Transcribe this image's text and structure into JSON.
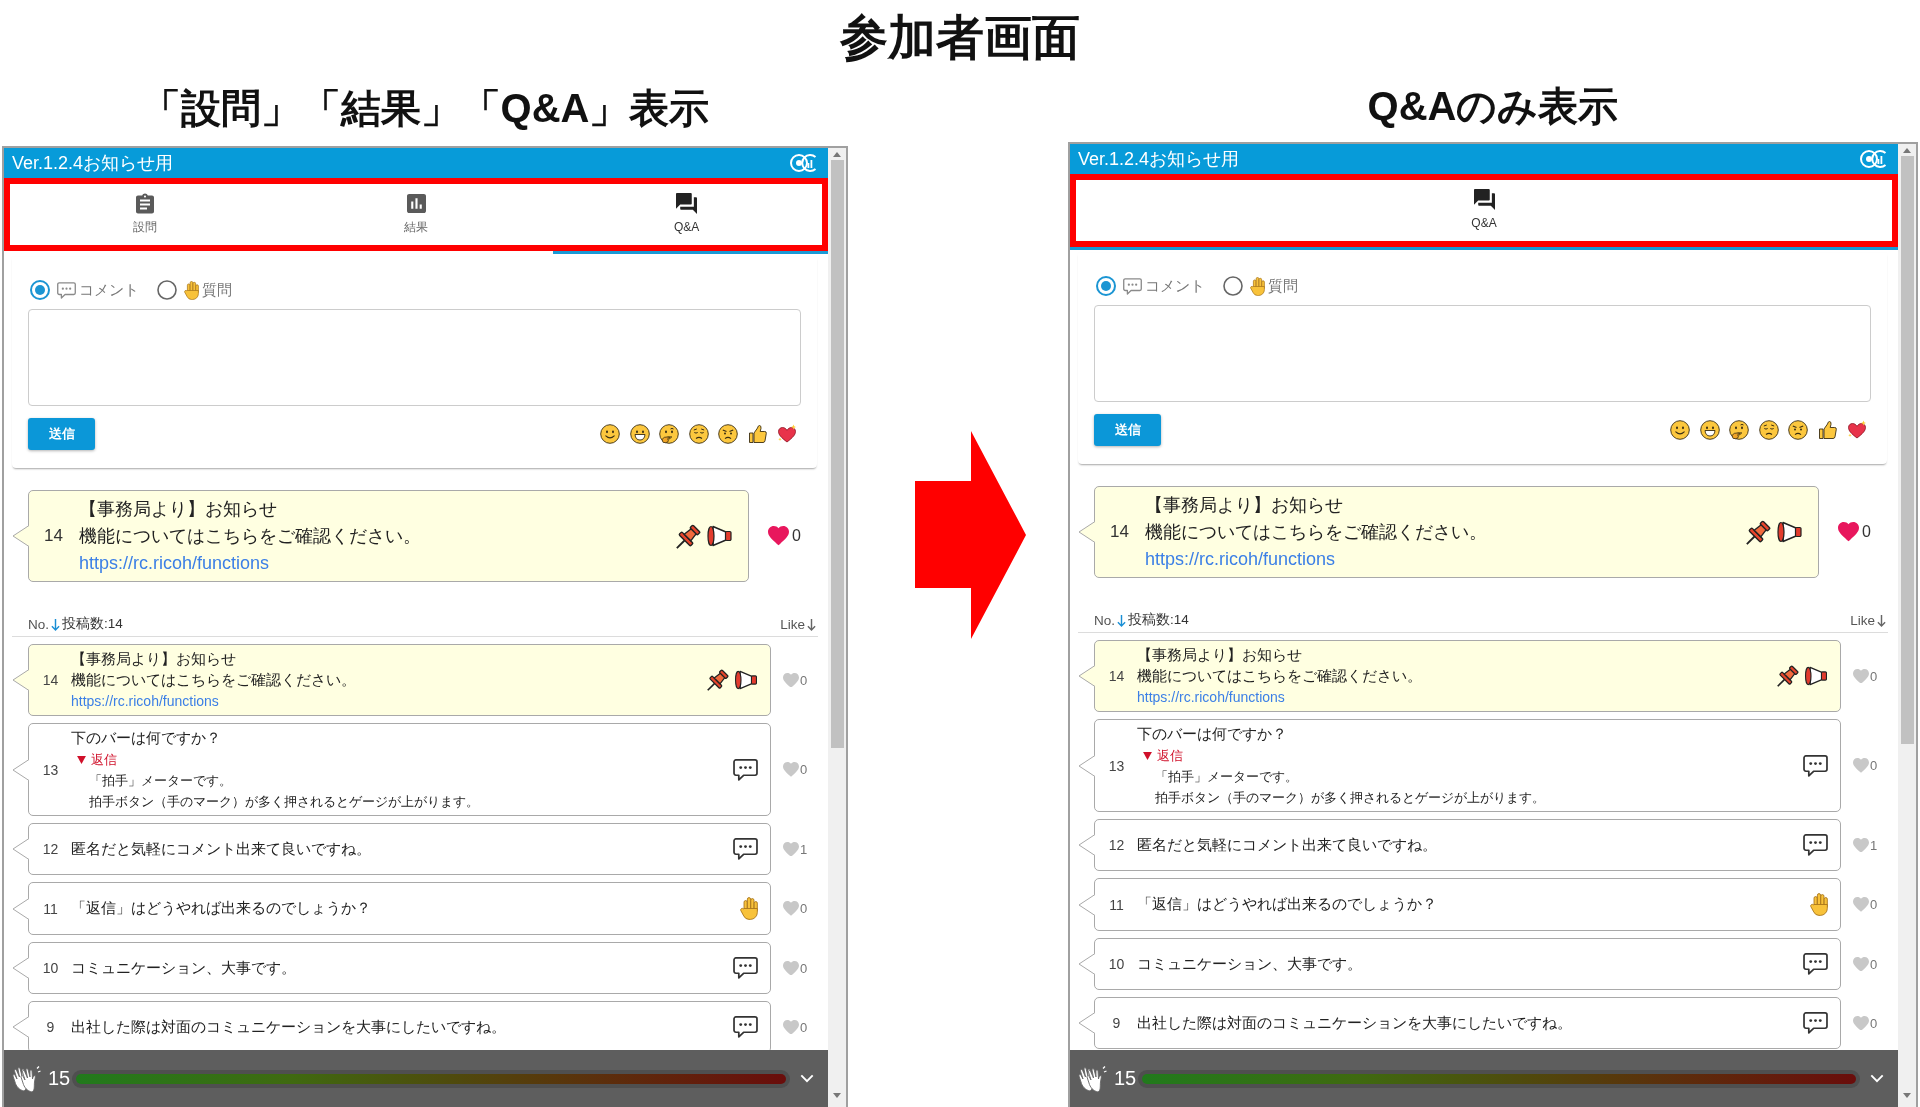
{
  "title": "参加者画面",
  "panels": [
    {
      "caption": "「設問」「結果」「Q&A」表示",
      "header": {
        "title": "Ver.1.2.4お知らせ用"
      },
      "highlight_tabs": true,
      "tabs": [
        {
          "kind": "questions",
          "label": "設問",
          "selected": false
        },
        {
          "kind": "results",
          "label": "結果",
          "selected": false
        },
        {
          "kind": "qa",
          "label": "Q&A",
          "selected": true
        }
      ],
      "composer": {
        "types": [
          {
            "kind": "comment",
            "label": "コメント",
            "selected": true
          },
          {
            "kind": "question",
            "label": "質問",
            "selected": false
          }
        ],
        "submit": "送信"
      },
      "featured": {
        "kind": "announcement",
        "number": "14",
        "lines": [
          "【事務局より】お知らせ",
          "機能についてはこちらをご確認ください。"
        ],
        "link": "https://rc.ricoh/functions",
        "likes": "0",
        "liked": true
      },
      "sort": {
        "number": {
          "label": "No.",
          "selected": true
        },
        "count": "投稿数:14",
        "like": {
          "label": "Like",
          "selected": false
        }
      },
      "posts": [
        {
          "kind": "announcement",
          "number": "14",
          "lines": [
            "【事務局より】お知らせ",
            "機能についてはこちらをご確認ください。"
          ],
          "link": "https://rc.ricoh/functions",
          "likes": "0",
          "liked": false
        },
        {
          "kind": "comment",
          "number": "13",
          "lines": [
            "下のバーは何ですか？"
          ],
          "reply": {
            "label": "返信",
            "expanded": true,
            "lines": [
              "「拍手」メーターです。",
              "拍手ボタン（手のマーク）が多く押されるとゲージが上がります。"
            ]
          },
          "likes": "0",
          "liked": false
        },
        {
          "kind": "comment",
          "number": "12",
          "lines": [
            "匿名だと気軽にコメント出来て良いですね。"
          ],
          "likes": "1",
          "liked": false
        },
        {
          "kind": "question",
          "number": "11",
          "lines": [
            "「返信」はどうやれば出来るのでしょうか？"
          ],
          "likes": "0",
          "liked": false
        },
        {
          "kind": "comment",
          "number": "10",
          "lines": [
            "コミュニケーション、大事です。"
          ],
          "likes": "0",
          "liked": false
        },
        {
          "kind": "comment",
          "number": "9",
          "lines": [
            "出社した際は対面のコミュニケーションを大事にしたいですね。"
          ],
          "likes": "0",
          "liked": false
        }
      ],
      "clap_bar": {
        "count": "15",
        "level": 1.0
      }
    },
    {
      "caption": "Q&Aのみ表示",
      "header": {
        "title": "Ver.1.2.4お知らせ用"
      },
      "highlight_tabs": true,
      "tabs": [
        {
          "kind": "qa",
          "label": "Q&A",
          "selected": true
        }
      ],
      "composer": {
        "types": [
          {
            "kind": "comment",
            "label": "コメント",
            "selected": true
          },
          {
            "kind": "question",
            "label": "質問",
            "selected": false
          }
        ],
        "submit": "送信"
      },
      "featured": {
        "kind": "announcement",
        "number": "14",
        "lines": [
          "【事務局より】お知らせ",
          "機能についてはこちらをご確認ください。"
        ],
        "link": "https://rc.ricoh/functions",
        "likes": "0",
        "liked": true
      },
      "sort": {
        "number": {
          "label": "No.",
          "selected": true
        },
        "count": "投稿数:14",
        "like": {
          "label": "Like",
          "selected": false
        }
      },
      "posts": [
        {
          "kind": "announcement",
          "number": "14",
          "lines": [
            "【事務局より】お知らせ",
            "機能についてはこちらをご確認ください。"
          ],
          "link": "https://rc.ricoh/functions",
          "likes": "0",
          "liked": false
        },
        {
          "kind": "comment",
          "number": "13",
          "lines": [
            "下のバーは何ですか？"
          ],
          "reply": {
            "label": "返信",
            "expanded": true,
            "lines": [
              "「拍手」メーターです。",
              "拍手ボタン（手のマーク）が多く押されるとゲージが上がります。"
            ]
          },
          "likes": "0",
          "liked": false
        },
        {
          "kind": "comment",
          "number": "12",
          "lines": [
            "匿名だと気軽にコメント出来て良いですね。"
          ],
          "likes": "1",
          "liked": false
        },
        {
          "kind": "question",
          "number": "11",
          "lines": [
            "「返信」はどうやれば出来るのでしょうか？"
          ],
          "likes": "0",
          "liked": false
        },
        {
          "kind": "comment",
          "number": "10",
          "lines": [
            "コミュニケーション、大事です。"
          ],
          "likes": "0",
          "liked": false
        },
        {
          "kind": "comment",
          "number": "9",
          "lines": [
            "出社した際は対面のコミュニケーションを大事にしたいですね。"
          ],
          "likes": "0",
          "liked": false
        }
      ],
      "clap_bar": {
        "count": "15",
        "level": 1.0
      }
    }
  ]
}
